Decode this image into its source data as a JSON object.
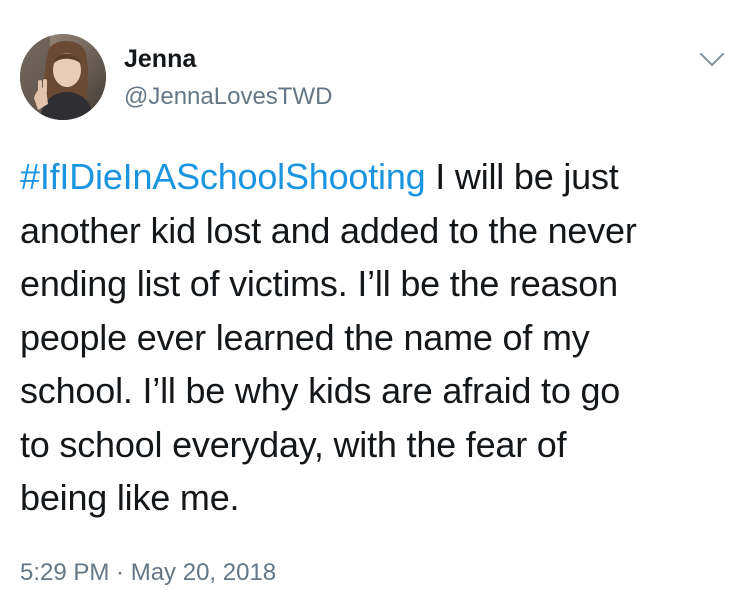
{
  "tweet": {
    "author": {
      "display_name": "Jenna",
      "handle": "@JennaLovesTWD"
    },
    "menu_icon": "chevron-down-icon",
    "hashtag": "#IfIDieInASchoolShooting",
    "text_lines": [
      " I will be just",
      "another kid lost and added to the never",
      "ending list of victims. I’ll be the reason",
      "people ever learned the name of my",
      "school. I’ll be why kids are afraid to go",
      "to school everyday, with the fear of",
      "being like me."
    ],
    "timestamp": "5:29 PM · May 20, 2018",
    "colors": {
      "text": "#14171a",
      "secondary": "#657786",
      "link": "#1b95e0",
      "background": "#ffffff"
    }
  }
}
